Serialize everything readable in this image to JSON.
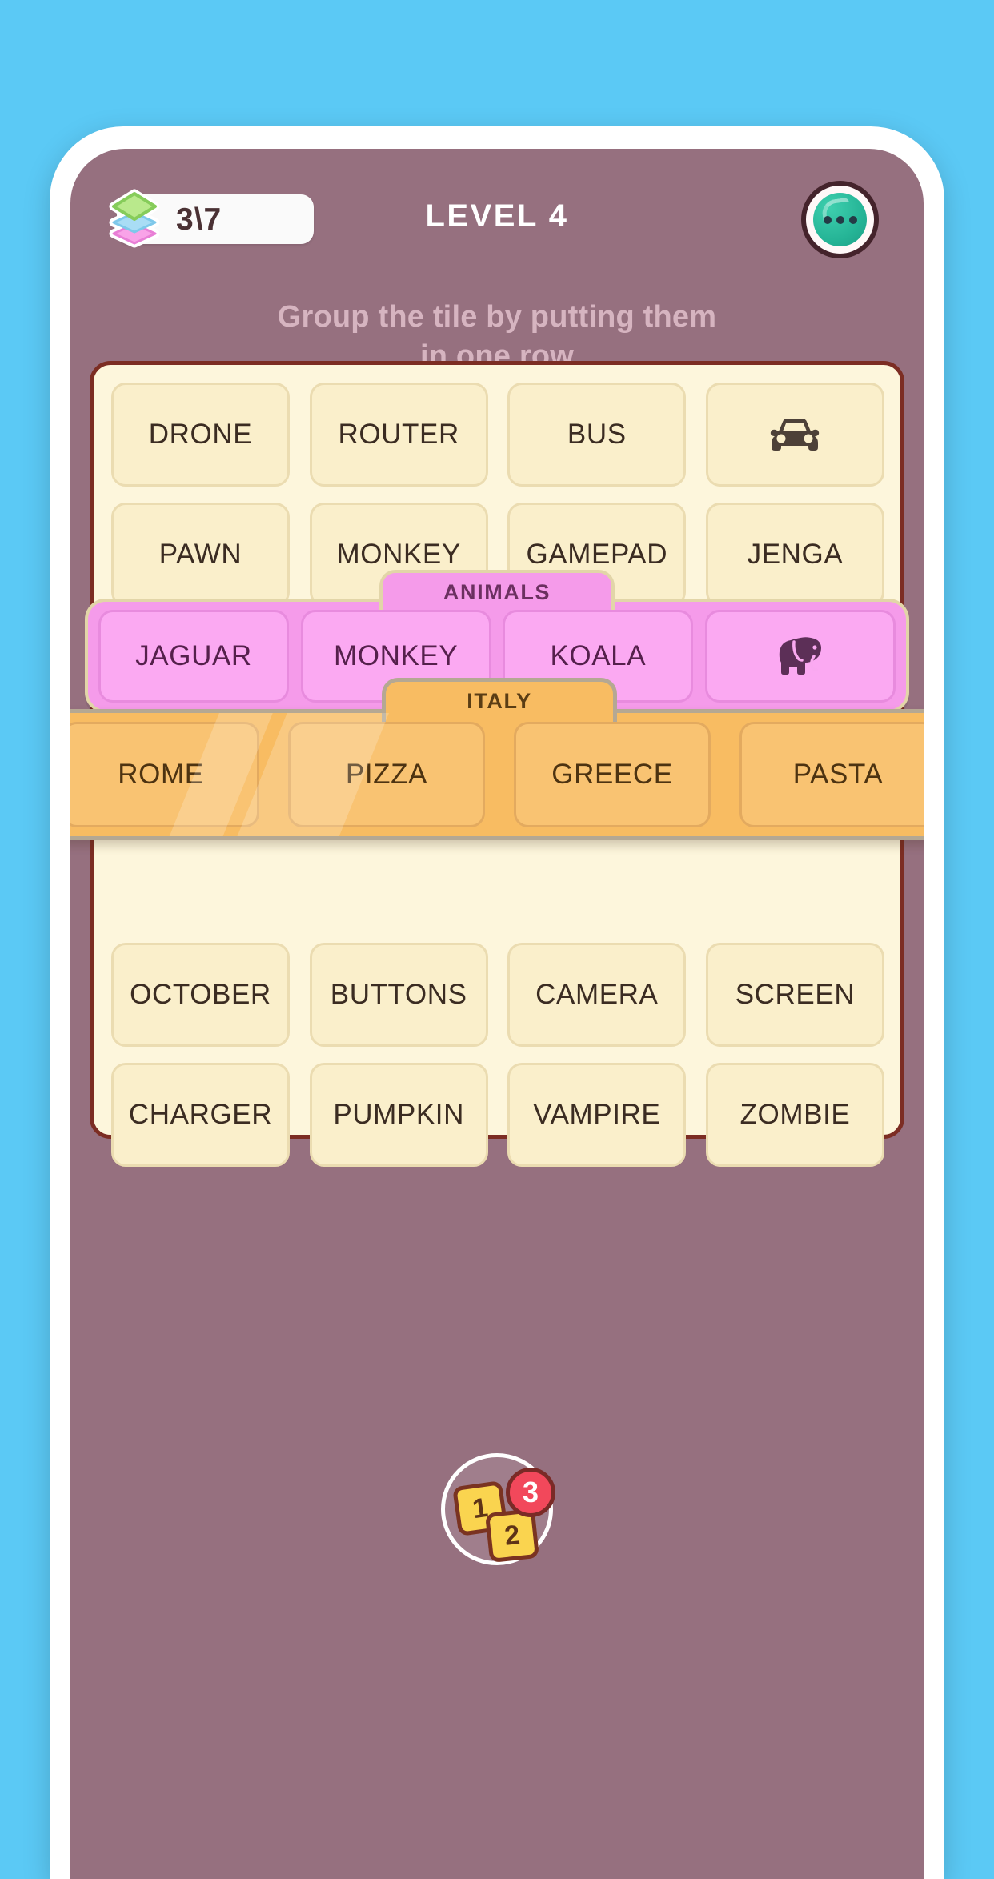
{
  "app": {
    "background_color": "#5BC9F5",
    "screen_color": "#96707F"
  },
  "header": {
    "progress": "3\\7",
    "progress_icon": "layer-stack-icon",
    "title": "LEVEL 4",
    "menu_icon": "ellipsis-icon"
  },
  "instruction": {
    "line1": "Group the tile by putting them",
    "line2": "in one row"
  },
  "board": {
    "background_color": "#FDF6DC",
    "border_color": "#7C2D23",
    "rows": [
      {
        "type": "plain",
        "tiles": [
          {
            "label": "DRONE",
            "icon": null
          },
          {
            "label": "ROUTER",
            "icon": null
          },
          {
            "label": "BUS",
            "icon": null
          },
          {
            "label": "",
            "icon": "car-icon"
          }
        ]
      },
      {
        "type": "plain",
        "tiles": [
          {
            "label": "PAWN",
            "icon": null
          },
          {
            "label": "MONKEY",
            "icon": null
          },
          {
            "label": "GAMEPAD",
            "icon": null
          },
          {
            "label": "JENGA",
            "icon": null
          }
        ]
      },
      {
        "type": "plain",
        "tiles": [
          {
            "label": "OCTOBER",
            "icon": null
          },
          {
            "label": "BUTTONS",
            "icon": null
          },
          {
            "label": "CAMERA",
            "icon": null
          },
          {
            "label": "SCREEN",
            "icon": null
          }
        ]
      },
      {
        "type": "plain",
        "tiles": [
          {
            "label": "CHARGER",
            "icon": null
          },
          {
            "label": "PUMPKIN",
            "icon": null
          },
          {
            "label": "VAMPIRE",
            "icon": null
          },
          {
            "label": "ZOMBIE",
            "icon": null
          }
        ]
      }
    ],
    "groups": [
      {
        "name": "ANIMALS",
        "color": "#F59BEA",
        "tiles": [
          {
            "label": "JAGUAR",
            "icon": null
          },
          {
            "label": "MONKEY",
            "icon": null
          },
          {
            "label": "KOALA",
            "icon": null
          },
          {
            "label": "",
            "icon": "elephant-icon"
          }
        ]
      },
      {
        "name": "ITALY",
        "color": "#F8BC62",
        "dragging": true,
        "tiles": [
          {
            "label": "ROME",
            "icon": null
          },
          {
            "label": "PIZZA",
            "icon": null
          },
          {
            "label": "GREECE",
            "icon": null
          },
          {
            "label": "PASTA",
            "icon": null
          }
        ]
      }
    ]
  },
  "deck": {
    "card1": "1",
    "card2": "2",
    "badge": "3"
  }
}
